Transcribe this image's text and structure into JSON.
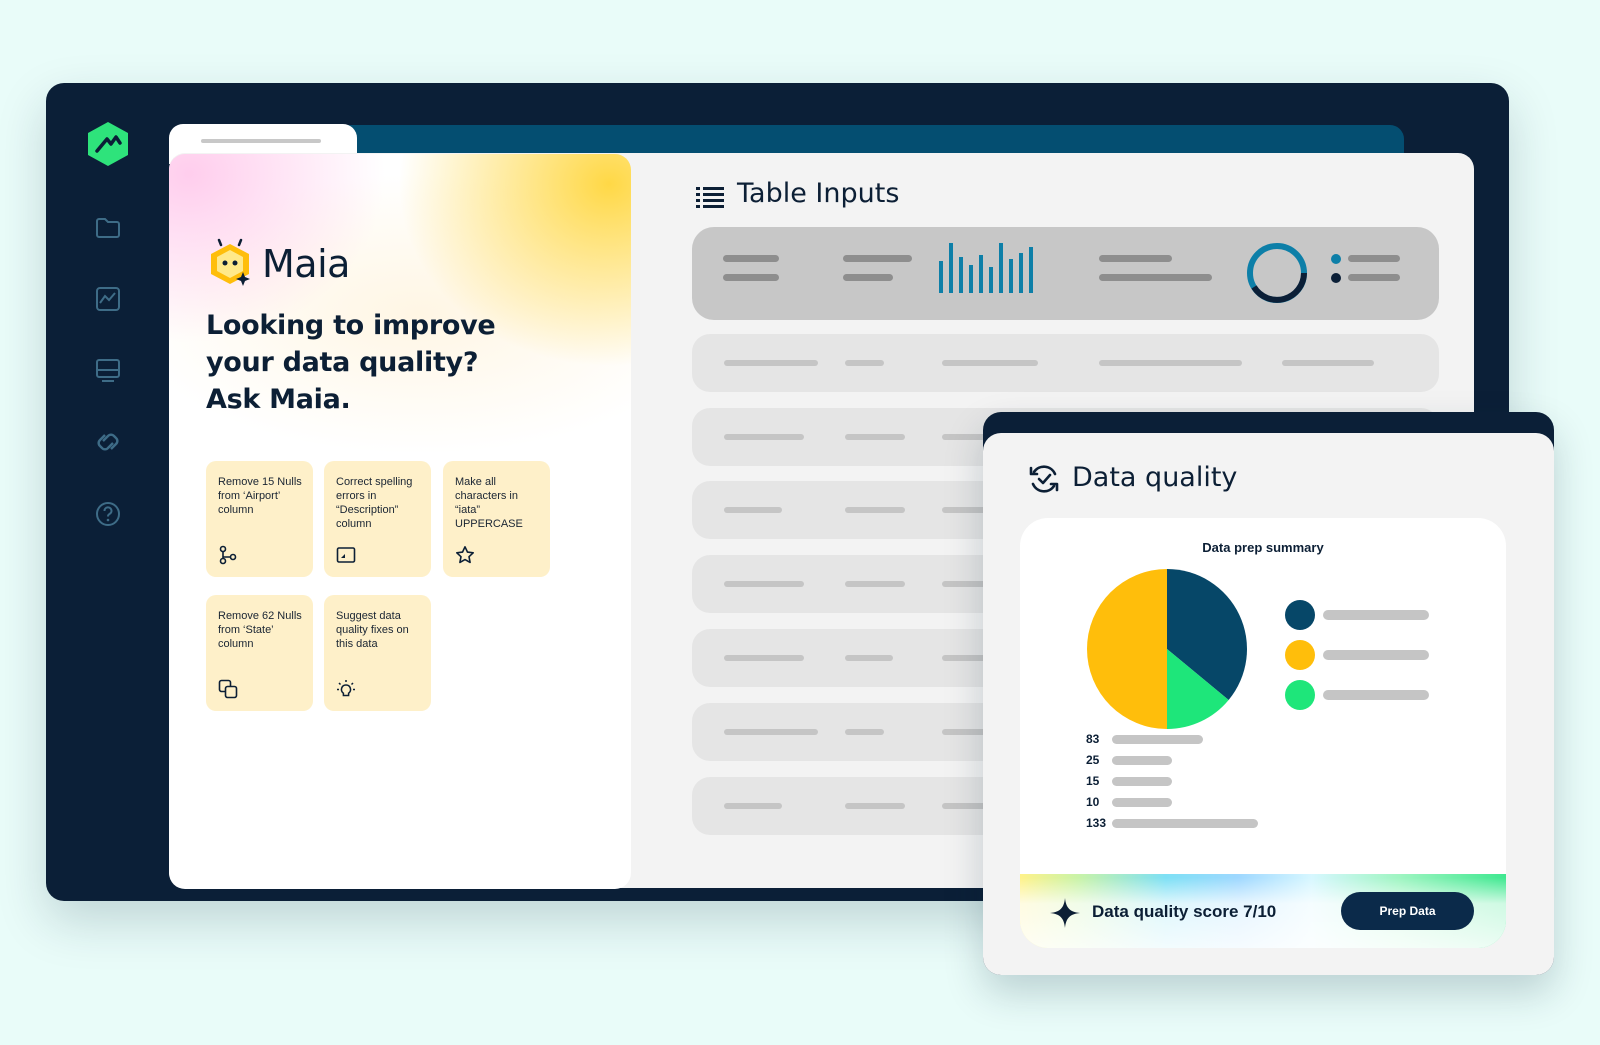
{
  "maia": {
    "name": "Maia",
    "headline_line1": "Looking to improve",
    "headline_line2": "your data quality?",
    "headline_line3": "Ask Maia.",
    "prompts": [
      {
        "label": "Remove 15 Nulls from ‘Airport’ column",
        "icon": "branch-icon"
      },
      {
        "label": "Correct spelling errors in “Description” column",
        "icon": "image-frame-icon"
      },
      {
        "label": "Make all characters in “iata” UPPERCASE",
        "icon": "star-icon"
      },
      {
        "label": "Remove 62 Nulls from ‘State’ column",
        "icon": "copy-icon"
      },
      {
        "label": "Suggest data quality fixes on this data",
        "icon": "lightbulb-icon"
      }
    ]
  },
  "table_inputs": {
    "title": "Table Inputs",
    "icon": "list-icon"
  },
  "data_quality": {
    "title": "Data quality",
    "icon": "refresh-check-icon",
    "summary_title": "Data prep summary",
    "score_text": "Data quality score 7/10",
    "prep_button": "Prep Data",
    "legend_colors": [
      "#064768",
      "#ffbe0b",
      "#1ee67a"
    ]
  },
  "chart_data": {
    "type": "pie",
    "title": "Data prep summary",
    "slices": [
      {
        "value": 36,
        "color": "#064768"
      },
      {
        "value": 14,
        "color": "#1ee67a"
      },
      {
        "value": 50,
        "color": "#ffbe0b"
      }
    ],
    "bars": [
      {
        "label": "83",
        "value": 83
      },
      {
        "label": "25",
        "value": 25
      },
      {
        "label": "15",
        "value": 15
      },
      {
        "label": "10",
        "value": 10
      },
      {
        "label": "133",
        "value": 133
      }
    ]
  },
  "colors": {
    "navy": "#0b1f37",
    "brand_green": "#2ee37b",
    "accent_yellow": "#ffbe0b",
    "teal": "#044e71",
    "chart_blue": "#0d7fa8"
  }
}
